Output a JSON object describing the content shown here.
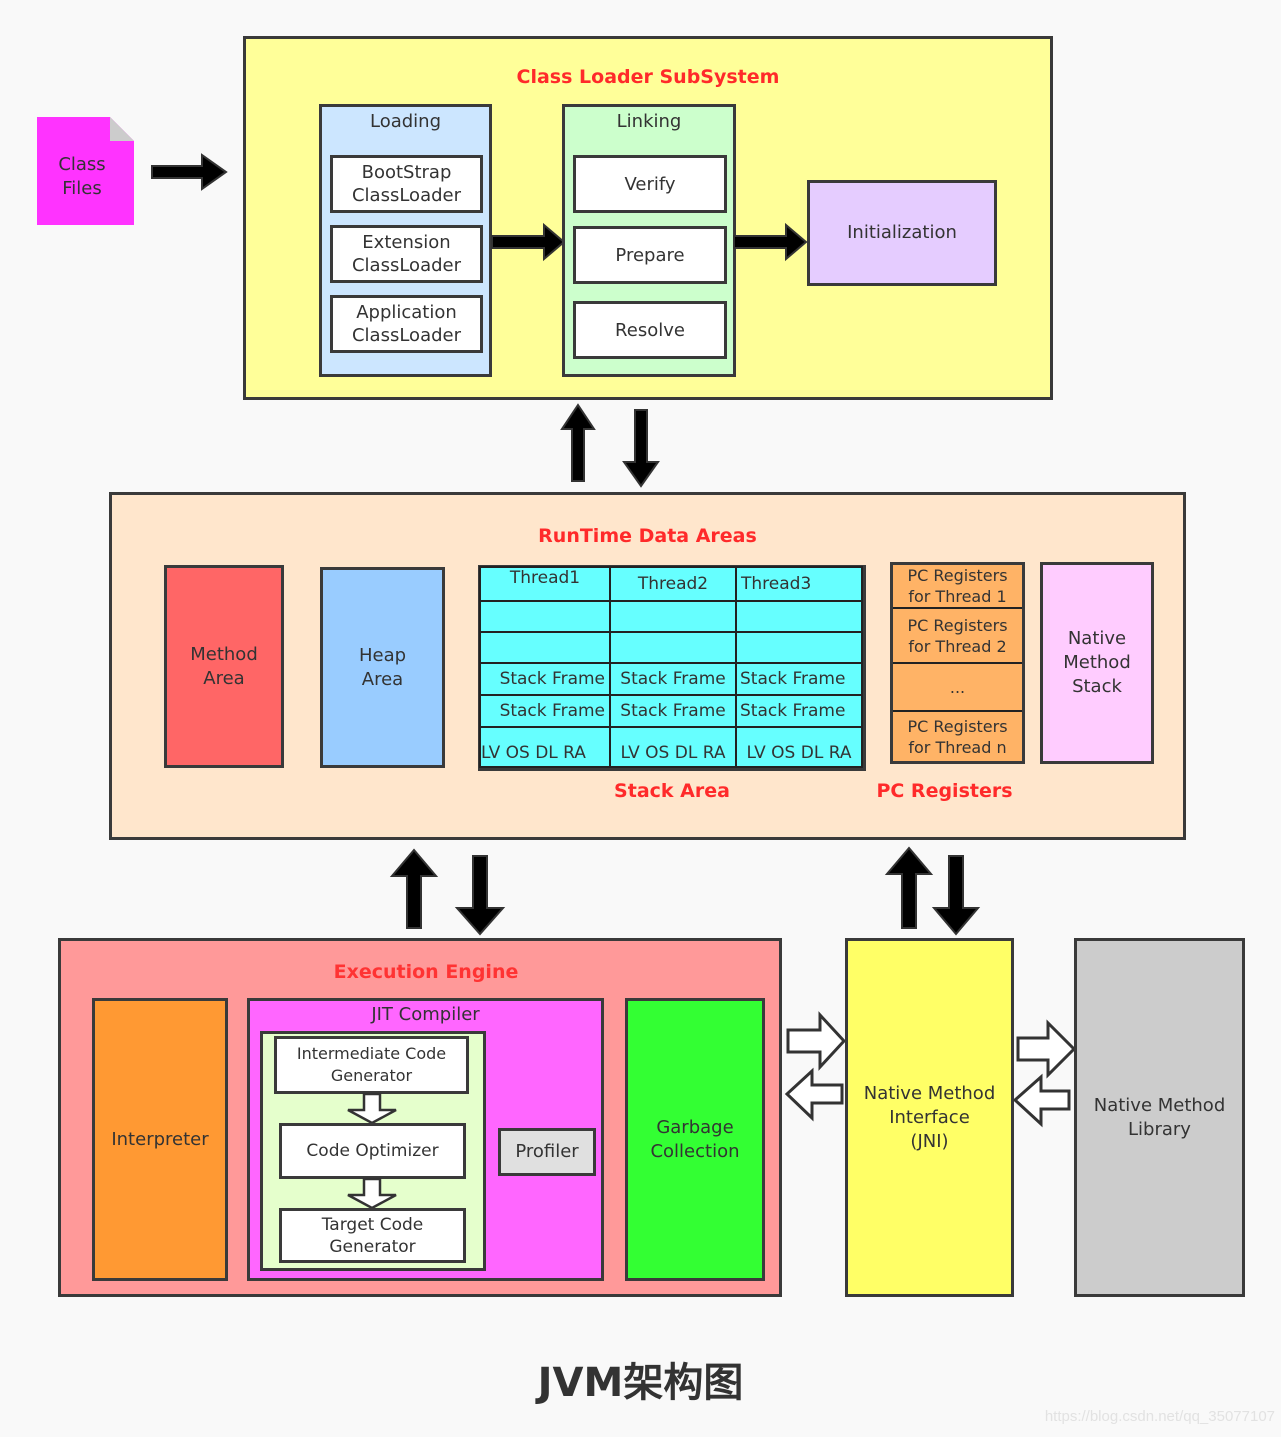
{
  "class_files": {
    "label": "Class\nFiles",
    "color": "#ff33ff"
  },
  "class_loader": {
    "title": "Class Loader SubSystem",
    "color": "#ffff99",
    "loading": {
      "label": "Loading",
      "items": [
        "BootStrap\nClassLoader",
        "Extension\nClassLoader",
        "Application\nClassLoader"
      ]
    },
    "linking": {
      "label": "Linking",
      "items": [
        "Verify",
        "Prepare",
        "Resolve"
      ]
    },
    "initialization": {
      "label": "Initialization"
    }
  },
  "runtime": {
    "title": "RunTime Data Areas",
    "method_area": "Method\nArea",
    "heap_area": "Heap\nArea",
    "stack_area": {
      "title": "Stack Area",
      "threads": [
        "Thread1",
        "Thread2",
        "Thread3"
      ],
      "rows": [
        [
          "",
          "",
          ""
        ],
        [
          "",
          "",
          ""
        ],
        [
          "Stack Frame",
          "Stack Frame",
          "Stack Frame"
        ],
        [
          "Stack Frame",
          "Stack Frame",
          "Stack Frame"
        ],
        [
          "LV OS DL RA",
          "LV OS DL RA",
          "LV OS DL RA"
        ]
      ]
    },
    "pc_registers": {
      "title": "PC Registers",
      "items": [
        "PC Registers\nfor Thread 1",
        "PC Registers\nfor Thread 2",
        "...",
        "PC Registers\nfor Thread n"
      ]
    },
    "native_method_stack": "Native\nMethod\nStack"
  },
  "execution_engine": {
    "title": "Execution Engine",
    "interpreter": "Interpreter",
    "jit": {
      "label": "JIT Compiler",
      "steps": [
        "Intermediate Code\nGenerator",
        "Code Optimizer",
        "Target Code\nGenerator"
      ],
      "profiler": "Profiler"
    },
    "gc": "Garbage\nCollection"
  },
  "jni": "Native Method\nInterface\n(JNI)",
  "native_library": "Native Method\nLibrary",
  "caption": "JVM架构图",
  "watermark": "https://blog.csdn.net/qq_35077107"
}
